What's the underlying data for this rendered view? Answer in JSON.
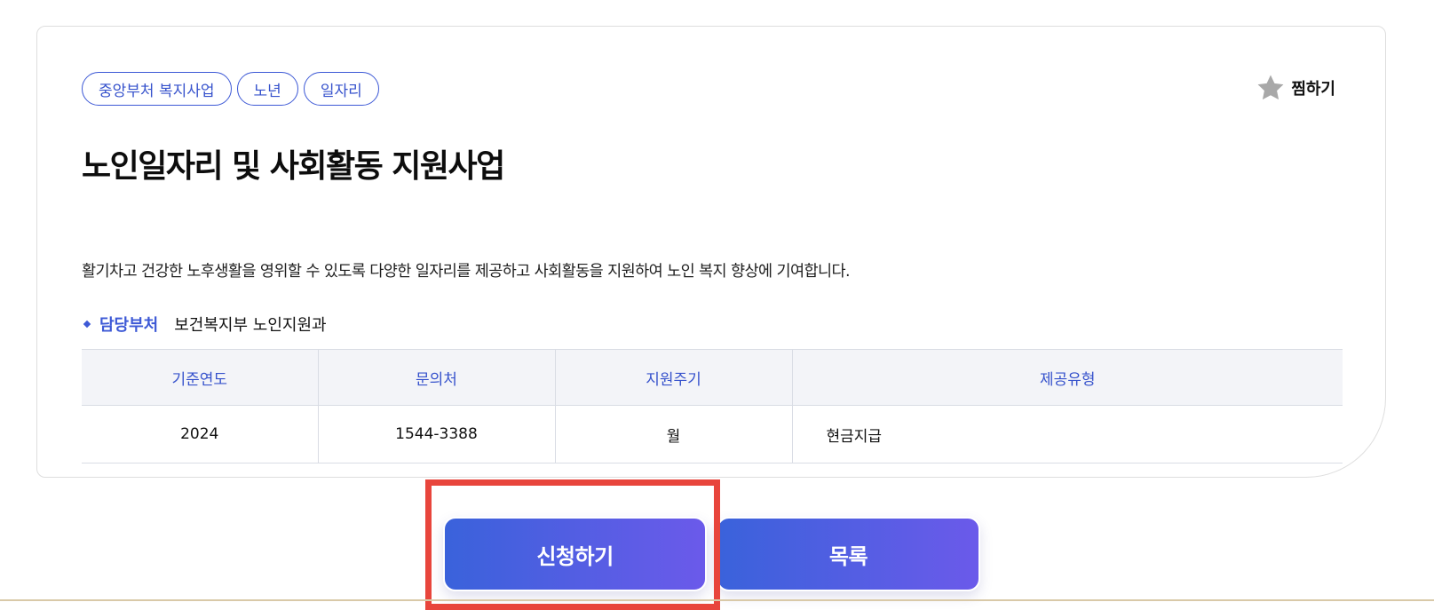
{
  "tags": [
    "중앙부처 복지사업",
    "노년",
    "일자리"
  ],
  "favorite": {
    "label": "찜하기",
    "icon": "star-icon",
    "icon_color": "#a8a8a8"
  },
  "title": "노인일자리 및 사회활동 지원사업",
  "description": "활기차고 건강한 노후생활을 영위할 수 있도록 다양한 일자리를 제공하고 사회활동을 지원하여 노인 복지 향상에 기여합니다.",
  "department": {
    "label": "담당부처",
    "value": "보건복지부 노인지원과"
  },
  "table": {
    "headers": [
      "기준연도",
      "문의처",
      "지원주기",
      "제공유형"
    ],
    "row": [
      "2024",
      "1544-3388",
      "월",
      "현금지급"
    ]
  },
  "buttons": {
    "apply": "신청하기",
    "list": "목록"
  },
  "colors": {
    "accent": "#3d59d6",
    "button_gradient_start": "#3a62db",
    "button_gradient_end": "#6b5aea",
    "highlight": "#e8453c"
  }
}
